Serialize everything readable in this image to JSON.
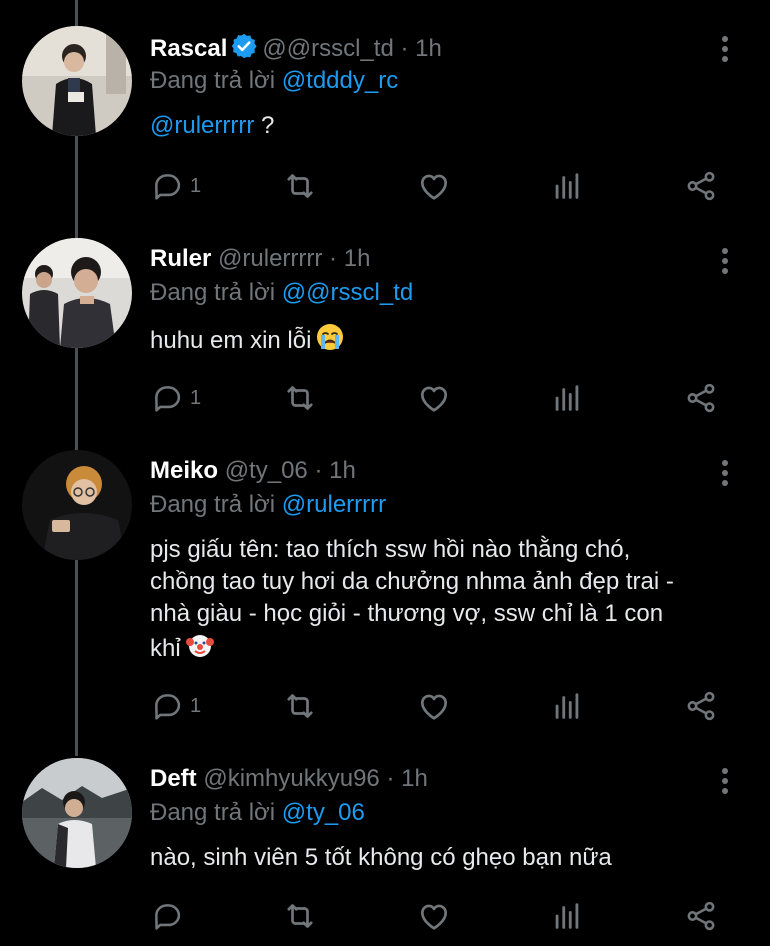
{
  "tweets": [
    {
      "name": "Rascal",
      "verified": true,
      "handle": "@@rsscl_td",
      "time": "1h",
      "reply_prefix": "Đang trả lời",
      "reply_to": "@tdddy_rc",
      "text_mention": "@rulerrrrr",
      "text": "?",
      "reply_count": "1"
    },
    {
      "name": "Ruler",
      "verified": false,
      "handle": "@rulerrrrr",
      "time": "1h",
      "reply_prefix": "Đang trả lời",
      "reply_to": "@@rsscl_td",
      "text": "huhu em xin lỗi",
      "emoji": "crying-face",
      "reply_count": "1"
    },
    {
      "name": "Meiko",
      "verified": false,
      "handle": "@ty_06",
      "time": "1h",
      "reply_prefix": "Đang trả lời",
      "reply_to": "@rulerrrrr",
      "text_lines": [
        "pjs giấu tên: tao thích ssw hồi nào thằng chó,",
        "chồng tao tuy hơi da chưởng nhma ảnh đẹp trai -",
        "nhà giàu - học giỏi - thương vợ, ssw chỉ là 1 con",
        "khỉ"
      ],
      "emoji": "clown-face",
      "reply_count": "1"
    },
    {
      "name": "Deft",
      "verified": false,
      "handle": "@kimhyukkyu96",
      "time": "1h",
      "reply_prefix": "Đang trả lời",
      "reply_to": "@ty_06",
      "text": "nào, sinh viên 5 tốt không có ghẹo bạn nữa",
      "reply_count": ""
    }
  ],
  "separator": "·",
  "colors": {
    "background": "#000000",
    "link": "#1d9bf0",
    "muted": "#71767b",
    "text": "#e7e9ea"
  }
}
